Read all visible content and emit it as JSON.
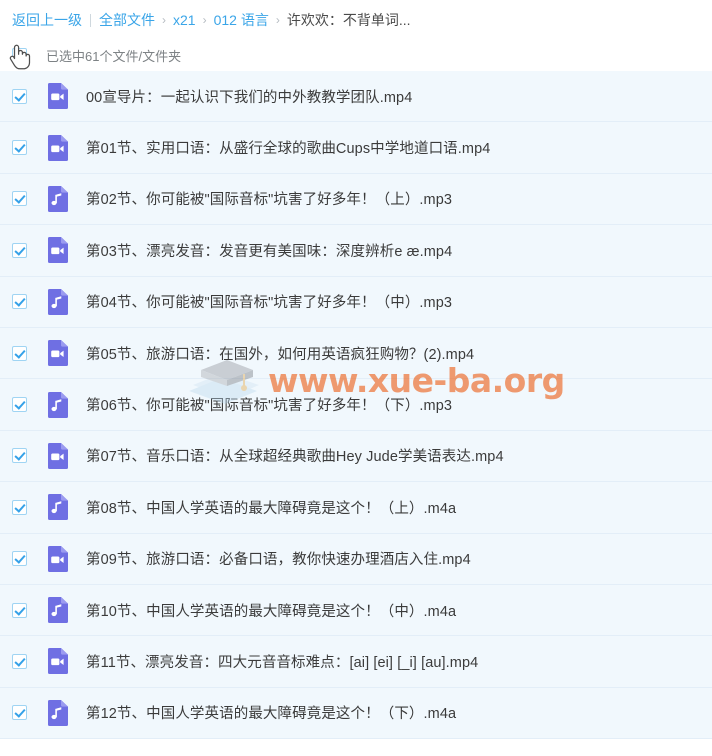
{
  "breadcrumb": {
    "back_label": "返回上一级",
    "items": [
      {
        "label": "全部文件",
        "type": "link"
      },
      {
        "label": "x21",
        "type": "link"
      },
      {
        "label": "012 语言",
        "type": "link"
      },
      {
        "label": "许欢欢：不背单词...",
        "type": "current"
      }
    ],
    "separator": "›",
    "link_color": "#3aa5e8",
    "current_color": "#4a4a4a"
  },
  "selection_bar": {
    "checkbox_checked": true,
    "label": "已选中61个文件/文件夹",
    "selected_count": 61,
    "cursor_icon": "hand-pointer-cursor"
  },
  "files": [
    {
      "name": "00宣导片：一起认识下我们的中外教教学团队.mp4",
      "kind": "video",
      "icon": "video-file-icon",
      "checked": true
    },
    {
      "name": "第01节、实用口语：从盛行全球的歌曲Cups中学地道口语.mp4",
      "kind": "video",
      "icon": "video-file-icon",
      "checked": true
    },
    {
      "name": "第02节、你可能被\"国际音标\"坑害了好多年！（上）.mp3",
      "kind": "audio",
      "icon": "audio-file-icon",
      "checked": true
    },
    {
      "name": "第03节、漂亮发音：发音更有美国味：深度辨析e æ.mp4",
      "kind": "video",
      "icon": "video-file-icon",
      "checked": true
    },
    {
      "name": "第04节、你可能被\"国际音标\"坑害了好多年！（中）.mp3",
      "kind": "audio",
      "icon": "audio-file-icon",
      "checked": true
    },
    {
      "name": "第05节、旅游口语：在国外，如何用英语疯狂购物？(2).mp4",
      "kind": "video",
      "icon": "video-file-icon",
      "checked": true
    },
    {
      "name": "第06节、你可能被\"国际音标\"坑害了好多年！（下）.mp3",
      "kind": "audio",
      "icon": "audio-file-icon",
      "checked": true
    },
    {
      "name": "第07节、音乐口语：从全球超经典歌曲Hey Jude学美语表达.mp4",
      "kind": "video",
      "icon": "video-file-icon",
      "checked": true
    },
    {
      "name": "第08节、中国人学英语的最大障碍竟是这个！（上）.m4a",
      "kind": "audio",
      "icon": "audio-file-icon",
      "checked": true
    },
    {
      "name": "第09节、旅游口语：必备口语，教你快速办理酒店入住.mp4",
      "kind": "video",
      "icon": "video-file-icon",
      "checked": true
    },
    {
      "name": "第10节、中国人学英语的最大障碍竟是这个！（中）.m4a",
      "kind": "audio",
      "icon": "audio-file-icon",
      "checked": true
    },
    {
      "name": "第11节、漂亮发音：四大元音音标难点：[ai] [ei] [_i] [au].mp4",
      "kind": "video",
      "icon": "video-file-icon",
      "checked": true
    },
    {
      "name": "第12节、中国人学英语的最大障碍竟是这个！（下）.m4a",
      "kind": "audio",
      "icon": "audio-file-icon",
      "checked": true
    }
  ],
  "watermark": {
    "text": "www.xue-ba.org",
    "color": "#eb5f19",
    "logo": "graduation-book-logo"
  },
  "theme": {
    "icon_purple": "#6f6fe3",
    "row_background": "#f1f8fd",
    "row_divider": "#e3eef8",
    "checkbox_accent": "#35a1e8"
  }
}
